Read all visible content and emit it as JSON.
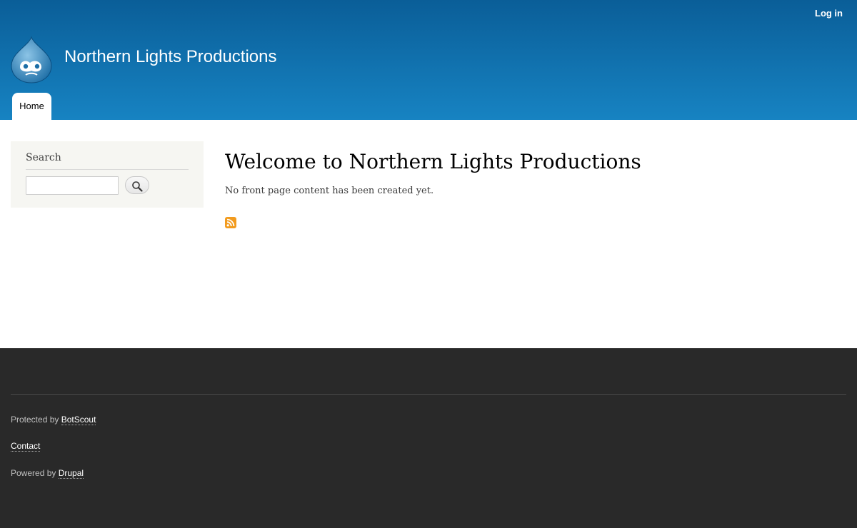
{
  "header": {
    "site_name": "Northern Lights Productions",
    "login_label": "Log in",
    "nav": [
      {
        "label": "Home"
      }
    ],
    "logo_icon": "drupal-drop-icon"
  },
  "sidebar": {
    "search": {
      "title": "Search",
      "input_value": "",
      "button_icon": "search-icon"
    }
  },
  "main": {
    "title": "Welcome to Northern Lights Productions",
    "message": "No front page content has been created yet.",
    "feed_icon": "rss-icon"
  },
  "footer": {
    "protected_prefix": "Protected by",
    "protected_link": "BotScout",
    "contact_label": "Contact",
    "powered_prefix": "Powered by",
    "powered_link": "Drupal"
  },
  "colors": {
    "header_top": "#0a5e98",
    "header_bottom": "#1783c2",
    "footer_bg": "#292929",
    "sidebar_bg": "#f6f6f2",
    "rss_orange": "#f29b1e"
  }
}
